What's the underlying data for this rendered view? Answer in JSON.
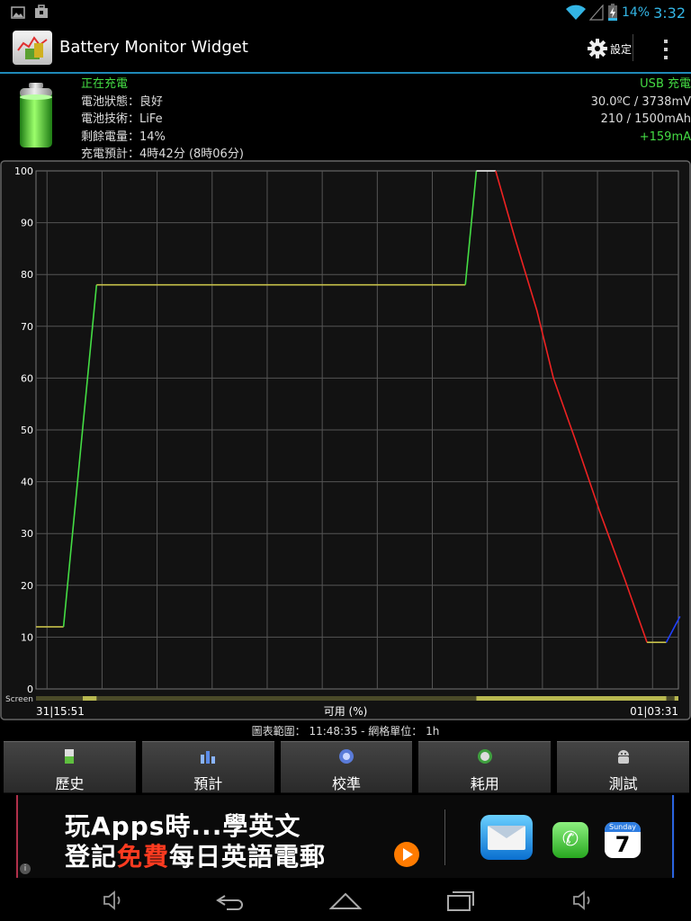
{
  "status_bar": {
    "battery_text": "14%",
    "clock": "3:32",
    "icons": [
      "image-icon",
      "briefcase-icon",
      "wifi-icon",
      "signal-icon",
      "battery-charging-icon"
    ]
  },
  "app_bar": {
    "title": "Battery Monitor Widget",
    "settings_label": "設定"
  },
  "info": {
    "charge_state": "正在充電",
    "battery_status": "電池狀態：良好",
    "battery_tech": "電池技術：LiFe",
    "remaining": "剩餘電量：14%",
    "charge_eta": "充電預計：4時42分 (8時06分)",
    "source": "USB 充電",
    "temp_voltage": "30.0ºC / 3738mV",
    "capacity": "210 / 1500mAh",
    "current": "+159mA"
  },
  "chart_data": {
    "type": "line",
    "ylim": [
      0,
      100
    ],
    "y_ticks": [
      "100",
      "90",
      "80",
      "70",
      "60",
      "50",
      "40",
      "30",
      "20",
      "10",
      "0"
    ],
    "x_start": "31|15:51",
    "x_end": "01|03:31",
    "xlabel": "可用 (%)",
    "screen_label": "Screen",
    "grid": true,
    "segments": [
      {
        "color": "#c6c04a",
        "points": [
          [
            0.0,
            12
          ],
          [
            0.5,
            12
          ]
        ]
      },
      {
        "color": "#44dd44",
        "points": [
          [
            0.5,
            12
          ],
          [
            1.1,
            78
          ]
        ]
      },
      {
        "color": "#c6c04a",
        "points": [
          [
            1.1,
            78
          ],
          [
            7.8,
            78
          ]
        ]
      },
      {
        "color": "#44dd44",
        "points": [
          [
            7.8,
            78
          ],
          [
            8.0,
            100
          ]
        ]
      },
      {
        "color": "#ffffff",
        "points": [
          [
            8.0,
            100
          ],
          [
            8.35,
            100
          ]
        ]
      },
      {
        "color": "#ee2222",
        "points": [
          [
            8.35,
            100
          ],
          [
            8.7,
            87
          ],
          [
            9.1,
            73
          ],
          [
            9.4,
            60
          ],
          [
            9.8,
            48
          ],
          [
            10.25,
            34
          ],
          [
            10.7,
            21
          ],
          [
            11.1,
            9
          ]
        ]
      },
      {
        "color": "#c6c04a",
        "points": [
          [
            11.1,
            9
          ],
          [
            11.45,
            9
          ]
        ]
      },
      {
        "color": "#2040ff",
        "points": [
          [
            11.45,
            9
          ],
          [
            11.7,
            14
          ]
        ]
      }
    ],
    "x_range_hours": [
      0,
      11.67
    ]
  },
  "chart_footer": {
    "range_text": "圖表範圍： 11:48:35 - 網格單位： 1h"
  },
  "nav_buttons": [
    {
      "label": "歷史",
      "icon": "history-icon"
    },
    {
      "label": "預計",
      "icon": "forecast-icon"
    },
    {
      "label": "校準",
      "icon": "calibrate-icon"
    },
    {
      "label": "耗用",
      "icon": "usage-icon"
    },
    {
      "label": "測試",
      "icon": "android-icon"
    }
  ],
  "ad": {
    "line1": "玩Apps時...學英文",
    "line2_pre": "登記",
    "line2_free": "免費",
    "line2_post": "每日英語電郵",
    "calendar_day": "Sunday",
    "calendar_num": "7",
    "info_glyph": "i"
  },
  "colors": {
    "accent": "#33b5e5",
    "green": "#44dd44",
    "red": "#ee2222",
    "olive": "#c6c04a"
  }
}
